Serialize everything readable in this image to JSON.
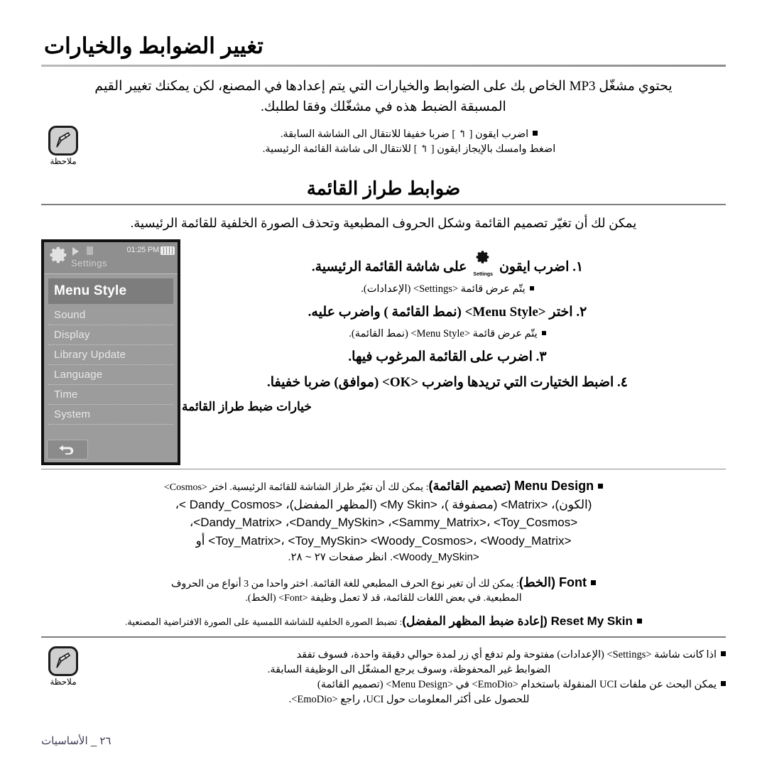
{
  "page": {
    "title": "تغيير الضوابط والخيارات",
    "intro_line1": "يحتوي مشغّل MP3 الخاص بك على الضوابط والخيارات التي يتم إعدادها في المصنع، لكن يمكنك تغيير القيم",
    "intro_line2": "المسبقة الضبط هذه في مشغّلك وفقا لطلبك.",
    "footer_section": "الأساسيات",
    "footer_sep": "_",
    "footer_page": "٢٦"
  },
  "note_top": {
    "badge_label": "ملاحظة",
    "icon": "note-pencil-icon",
    "lines": [
      "اضرب ايقون [ ↰ ] ضربا خفيفا للانتقال الى الشاشة السابقة.",
      "اضغط وامسك بالإيجاز ايقون [ ↰ ] للانتقال الى شاشة القائمة الرئيسية."
    ]
  },
  "menu_style_section": {
    "heading": "ضوابط طراز القائمة",
    "intro": "يمكن لك أن تغيّر تصميم القائمة وشكل الحروف المطبعية وتحذف الصورة الخلفية للقائمة الرئيسية.",
    "steps": [
      {
        "num": "١.",
        "text_before": "اضرب ايقون",
        "icon": "settings-gear-icon",
        "icon_caption": "Settings",
        "text_after": "على شاشة القائمة الرئيسية.",
        "sub": "يتّم عرض قائمة <Settings> (الإعدادات)."
      },
      {
        "num": "٢.",
        "text": "اختر <Menu Style> (نمط القائمة ) واضرب عليه.",
        "sub": "يتّم عرض قائمة <Menu Style> (نمط القائمة)."
      },
      {
        "num": "٣.",
        "text": "اضرب على القائمة المرغوب فيها.",
        "sub": ""
      },
      {
        "num": "٤.",
        "text": "اضبط الختيارت التي تريدها واضرب <OK> (موافق) ضربا خفيفا.",
        "sub": ""
      }
    ]
  },
  "device": {
    "status_time": "01:25 PM",
    "screen_title": "Settings",
    "icons": [
      "gear-icon",
      "play-icon",
      "usb-icon",
      "battery-icon"
    ],
    "menu_items": [
      {
        "label": "Menu Style",
        "selected": true
      },
      {
        "label": "Sound",
        "selected": false
      },
      {
        "label": "Display",
        "selected": false
      },
      {
        "label": "Library Update",
        "selected": false
      },
      {
        "label": "Language",
        "selected": false
      },
      {
        "label": "Time",
        "selected": false
      },
      {
        "label": "System",
        "selected": false
      }
    ],
    "back_button": "back-arrow-icon"
  },
  "options_section": {
    "heading": "خيارات ضبط طراز القائمة",
    "menu_design": {
      "lead": "Menu Design (تصميم القائمة)",
      "desc": ": يمكن لك أن تغيّر طراز الشاشة للقائمة الرئيسية. اختر <Cosmos>",
      "themes_line1": "(الكون)، <Matrix> (مصفوفة )، <My Skin> (المظهر المفضل)،  <Dandy_Cosmos >،",
      "themes_line2": "<Dandy_Matrix> ،<Dandy_MySkin> ،<Sammy_Matrix>، <Toy_Cosmos>،",
      "themes_line3": "<Toy_Matrix>، <Toy_MySkin> <Woody_Cosmos>، <Woody_Matrix> أو",
      "themes_line4": "<Woody_MySkin>. انظر صفحات ٢٧ ~ ٢٨."
    },
    "font": {
      "lead": "Font (الخط)",
      "desc_line1": ": يمكن لك أن تغير نوع الحرف المطبعي للغة القائمة. اختر واحدا من 3 أنواع من الحروف",
      "desc_line2": "المطبعية. في بعض اللغات للقائمة، قد لا تعمل وظيفة <Font> (الخط)."
    },
    "reset_my_skin": {
      "lead": "Reset My Skin (إعادة ضبط المظهر المفضل)",
      "desc": ": تضبط الصورة الخلفية للشاشة اللمسية على الصورة الافتراضية المصنعية."
    }
  },
  "note_bottom": {
    "badge_label": "ملاحظة",
    "icon": "note-pencil-icon",
    "line1a": "اذا كانت شاشة <Settings> (الإعدادات) مفتوحة ولم تدفع أي زر لمدة حوالي دقيقة واحدة، فسوف تفقد",
    "line1b": "الضوابط غير المحفوظة، وسوف يرجع المشغّل الى الوظيفة السابقة.",
    "line2a": "يمكن البحث عن ملفات UCI المنقولة باستخدام <EmoDio> في <Menu Design> (تصميم القائمة)",
    "line2b": "للحصول على أكثر المعلومات حول UCI، راجع <EmoDio>."
  }
}
